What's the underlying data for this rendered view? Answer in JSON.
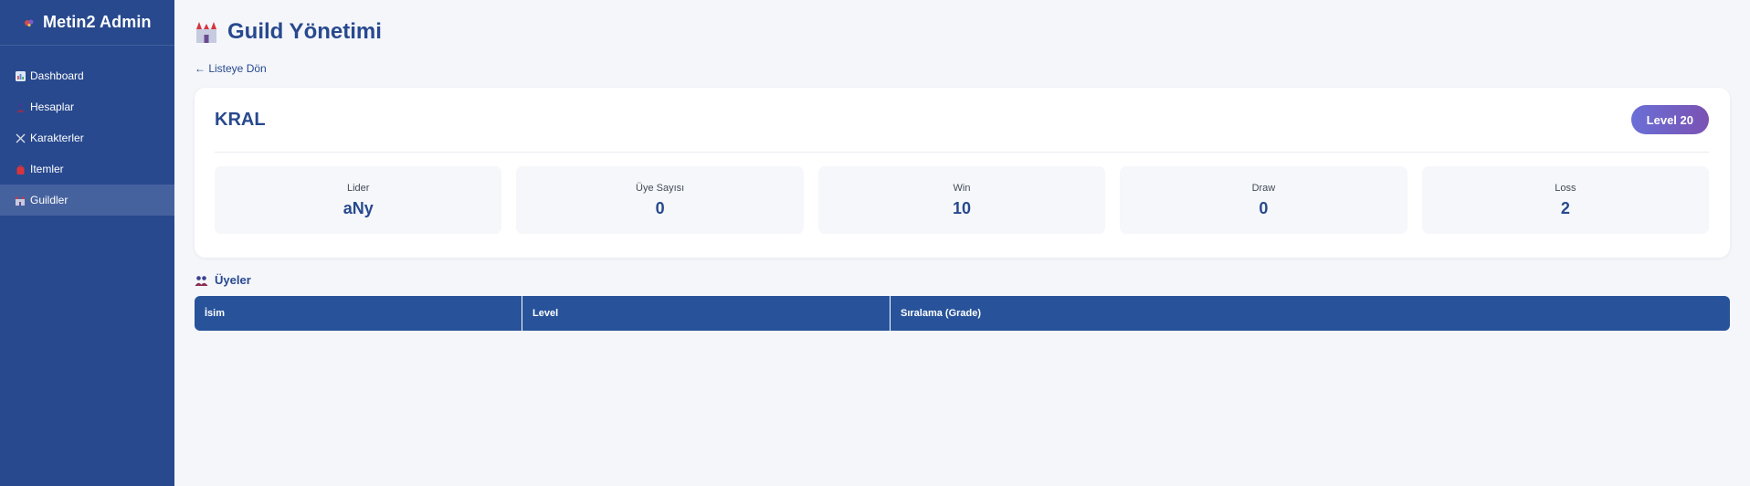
{
  "sidebar": {
    "brand": "Metin2 Admin",
    "brand_icon": "dragon-icon",
    "items": [
      {
        "label": "Dashboard",
        "icon": "chart-icon",
        "active": false
      },
      {
        "label": "Hesaplar",
        "icon": "user-icon",
        "active": false
      },
      {
        "label": "Karakterler",
        "icon": "swords-icon",
        "active": false
      },
      {
        "label": "Itemler",
        "icon": "bag-icon",
        "active": false
      },
      {
        "label": "Guildler",
        "icon": "castle-icon",
        "active": true
      }
    ]
  },
  "page": {
    "title": "Guild Yönetimi",
    "title_icon": "castle-icon",
    "back_link": "← Listeye Dön"
  },
  "guild": {
    "name": "KRAL",
    "level_badge": "Level 20",
    "stats": [
      {
        "label": "Lider",
        "value": "aNy"
      },
      {
        "label": "Üye Sayısı",
        "value": "0"
      },
      {
        "label": "Win",
        "value": "10"
      },
      {
        "label": "Draw",
        "value": "0"
      },
      {
        "label": "Loss",
        "value": "2"
      }
    ]
  },
  "members": {
    "heading": "Üyeler",
    "heading_icon": "users-icon",
    "columns": [
      "İsim",
      "Level",
      "Sıralama (Grade)"
    ],
    "rows": []
  },
  "colors": {
    "sidebar_bg": "#28498e",
    "accent": "#28498e",
    "table_header": "#28539a",
    "badge_gradient_start": "#6a6fd6",
    "badge_gradient_end": "#7a52b3",
    "page_bg": "#f4f6fa"
  }
}
